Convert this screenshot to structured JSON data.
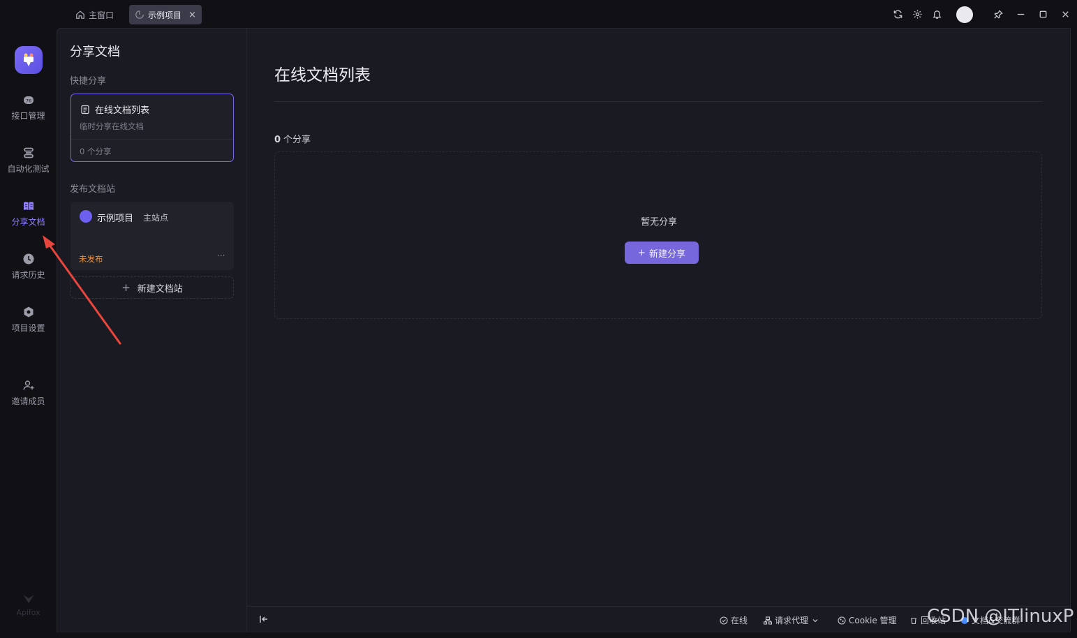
{
  "titlebar": {
    "tabs": [
      {
        "label": "主窗口",
        "icon": "home-icon"
      },
      {
        "label": "示例项目",
        "icon": "project-icon",
        "close": "×"
      }
    ],
    "icons": [
      "refresh-icon",
      "gear-icon",
      "bell-icon",
      "avatar",
      "pin-icon",
      "minimize-icon",
      "maximize-icon",
      "close-icon"
    ]
  },
  "rail": {
    "items": [
      {
        "label": "接口管理",
        "icon": "api-icon"
      },
      {
        "label": "自动化测试",
        "icon": "automation-icon"
      },
      {
        "label": "分享文档",
        "icon": "book-icon",
        "active": true
      },
      {
        "label": "请求历史",
        "icon": "clock-icon"
      },
      {
        "label": "项目设置",
        "icon": "hexagon-settings-icon"
      },
      {
        "label": "邀请成员",
        "icon": "invite-user-icon"
      }
    ],
    "footer": "Apifox"
  },
  "sidebar": {
    "title": "分享文档",
    "quick_share_label": "快捷分享",
    "online_card": {
      "title": "在线文档列表",
      "subtitle": "临时分享在线文档",
      "count": "0 个分享"
    },
    "publish_label": "发布文档站",
    "site_card": {
      "name": "示例项目",
      "tag": "主站点",
      "status": "未发布",
      "more": "···"
    },
    "new_site_label": "新建文档站"
  },
  "main": {
    "title": "在线文档列表",
    "count_num": "0",
    "count_label": "个分享",
    "empty_text": "暂无分享",
    "new_share_label": "新建分享"
  },
  "statusbar": {
    "online": "在线",
    "proxy": "请求代理",
    "cookie": "Cookie 管理",
    "recycle": "回收站",
    "docs": "文档&交流群"
  },
  "watermark": "CSDN @ITlinuxP",
  "colors": {
    "accent": "#7667dc",
    "active_nav": "#8f80ff",
    "warning": "#e0903a",
    "arrow": "#e8463c"
  }
}
